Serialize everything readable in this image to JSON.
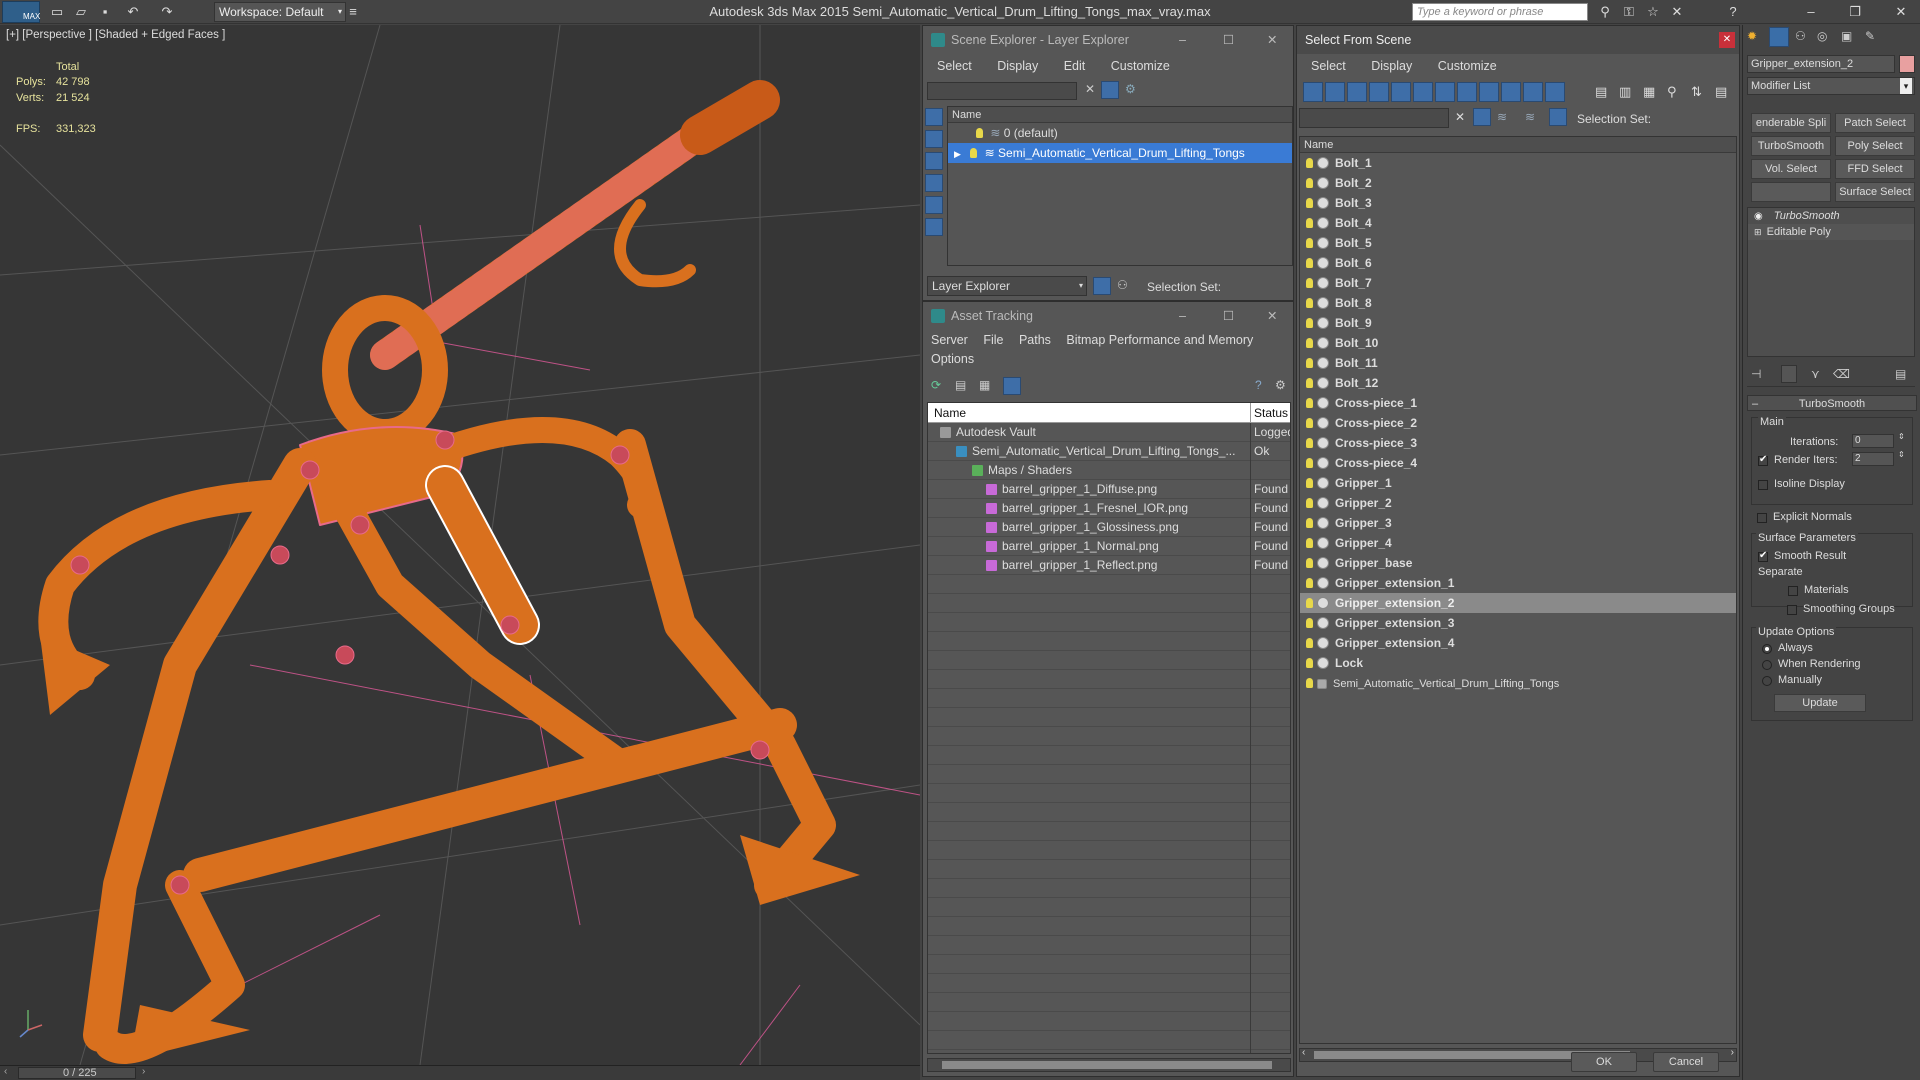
{
  "app": {
    "title": "Autodesk 3ds Max  2015    Semi_Automatic_Vertical_Drum_Lifting_Tongs_max_vray.max",
    "workspace": "Workspace: Default",
    "search_placeholder": "Type a keyword or phrase",
    "logo": "MAX"
  },
  "viewport": {
    "label": "[+] [Perspective ] [Shaded + Edged Faces ]",
    "stats": {
      "total": "Total",
      "polys_label": "Polys:",
      "polys": "42 798",
      "verts_label": "Verts:",
      "verts": "21 524",
      "fps_label": "FPS:",
      "fps": "331,323"
    },
    "timeline": "0 / 225"
  },
  "scene_explorer": {
    "title": "Scene Explorer - Layer Explorer",
    "menu": [
      "Select",
      "Display",
      "Edit",
      "Customize"
    ],
    "column": "Name",
    "layers": [
      "0 (default)",
      "Semi_Automatic_Vertical_Drum_Lifting_Tongs"
    ],
    "bottom_dropdown": "Layer Explorer",
    "selection_set": "Selection Set:"
  },
  "asset_tracking": {
    "title": "Asset Tracking",
    "menu": [
      "Server",
      "File",
      "Paths",
      "Bitmap Performance and Memory"
    ],
    "menu2": "Options",
    "col_name": "Name",
    "col_status": "Status",
    "rows": [
      {
        "name": "Autodesk Vault",
        "status": "Logged"
      },
      {
        "name": "Semi_Automatic_Vertical_Drum_Lifting_Tongs_...",
        "status": "Ok"
      },
      {
        "name": "Maps / Shaders",
        "status": ""
      },
      {
        "name": "barrel_gripper_1_Diffuse.png",
        "status": "Found"
      },
      {
        "name": "barrel_gripper_1_Fresnel_IOR.png",
        "status": "Found"
      },
      {
        "name": "barrel_gripper_1_Glossiness.png",
        "status": "Found"
      },
      {
        "name": "barrel_gripper_1_Normal.png",
        "status": "Found"
      },
      {
        "name": "barrel_gripper_1_Reflect.png",
        "status": "Found"
      }
    ]
  },
  "select_from_scene": {
    "title": "Select From Scene",
    "menu": [
      "Select",
      "Display",
      "Customize"
    ],
    "selection_set": "Selection Set:",
    "column": "Name",
    "items": [
      "Bolt_1",
      "Bolt_2",
      "Bolt_3",
      "Bolt_4",
      "Bolt_5",
      "Bolt_6",
      "Bolt_7",
      "Bolt_8",
      "Bolt_9",
      "Bolt_10",
      "Bolt_11",
      "Bolt_12",
      "Cross-piece_1",
      "Cross-piece_2",
      "Cross-piece_3",
      "Cross-piece_4",
      "Gripper_1",
      "Gripper_2",
      "Gripper_3",
      "Gripper_4",
      "Gripper_base",
      "Gripper_extension_1",
      "Gripper_extension_2",
      "Gripper_extension_3",
      "Gripper_extension_4",
      "Lock",
      "Semi_Automatic_Vertical_Drum_Lifting_Tongs"
    ],
    "selected": "Gripper_extension_2",
    "ok": "OK",
    "cancel": "Cancel"
  },
  "modify_panel": {
    "object_name": "Gripper_extension_2",
    "modifier_list": "Modifier List",
    "buttons": [
      "enderable Spli",
      "Patch Select",
      "TurboSmooth",
      "Poly Select",
      "Vol. Select",
      "FFD Select",
      "",
      "Surface Select"
    ],
    "stack": [
      "TurboSmooth",
      "Editable Poly"
    ],
    "rollout_title": "TurboSmooth",
    "main": "Main",
    "iterations_label": "Iterations:",
    "iterations": "0",
    "render_iters_label": "Render Iters:",
    "render_iters": "2",
    "isoline": "Isoline Display",
    "explicit": "Explicit Normals",
    "surface_params": "Surface Parameters",
    "smooth_result": "Smooth Result",
    "separate": "Separate",
    "materials": "Materials",
    "smoothing_groups": "Smoothing Groups",
    "update_options": "Update Options",
    "always": "Always",
    "when_rendering": "When Rendering",
    "manually": "Manually",
    "update": "Update"
  }
}
